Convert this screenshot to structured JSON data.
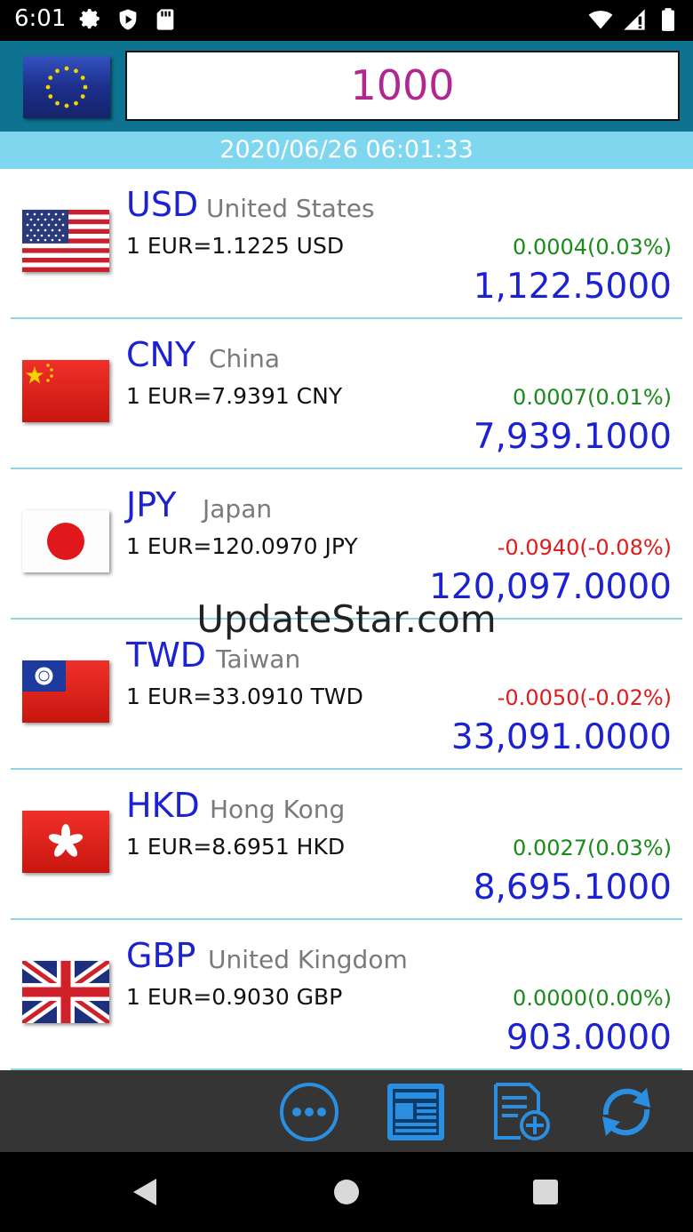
{
  "status_bar": {
    "time": "6:01"
  },
  "header": {
    "base_flag": "eu-flag-icon",
    "amount": "1000"
  },
  "timestamp": "2020/06/26 06:01:33",
  "rows": [
    {
      "code": "USD",
      "country": "United States",
      "rate": "1 EUR=1.1225 USD",
      "change": "0.0004(0.03%)",
      "direction": "up",
      "converted": "1,122.5000",
      "flag": "us-flag-icon"
    },
    {
      "code": "CNY",
      "country": "China",
      "rate": "1 EUR=7.9391 CNY",
      "change": "0.0007(0.01%)",
      "direction": "up",
      "converted": "7,939.1000",
      "flag": "cn-flag-icon"
    },
    {
      "code": "JPY",
      "country": "Japan",
      "rate": "1 EUR=120.0970 JPY",
      "change": "-0.0940(-0.08%)",
      "direction": "down",
      "converted": "120,097.0000",
      "flag": "jp-flag-icon"
    },
    {
      "code": "TWD",
      "country": "Taiwan",
      "rate": "1 EUR=33.0910 TWD",
      "change": "-0.0050(-0.02%)",
      "direction": "down",
      "converted": "33,091.0000",
      "flag": "tw-flag-icon"
    },
    {
      "code": "HKD",
      "country": "Hong Kong",
      "rate": "1 EUR=8.6951 HKD",
      "change": "0.0027(0.03%)",
      "direction": "up",
      "converted": "8,695.1000",
      "flag": "hk-flag-icon"
    },
    {
      "code": "GBP",
      "country": "United Kingdom",
      "rate": "1 EUR=0.9030 GBP",
      "change": "0.0000(0.00%)",
      "direction": "up",
      "converted": "903.0000",
      "flag": "gb-flag-icon"
    }
  ],
  "watermark": "UpdateStar.com",
  "toolbar": {
    "buttons": [
      "more-icon",
      "news-icon",
      "add-list-icon",
      "refresh-icon"
    ],
    "accent": "#2a8fe0"
  },
  "navbar": {
    "buttons": [
      "back-icon",
      "home-icon",
      "recents-icon"
    ]
  },
  "colors": {
    "header": "#0e7390",
    "timestamp_bar": "#7fd6ef",
    "amount": "#b1278f",
    "code": "#1c22d0",
    "up": "#1a8a1a",
    "down": "#e01b1b"
  }
}
